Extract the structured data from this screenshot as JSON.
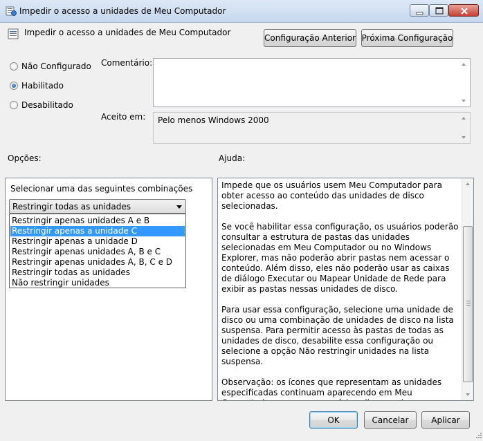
{
  "window": {
    "title": "Impedir o acesso a unidades de Meu Computador",
    "controls": {
      "minimize": "minimize",
      "maximize": "maximize",
      "close": "close"
    }
  },
  "header": {
    "policy_title": "Impedir o acesso a unidades de Meu Computador",
    "prev_button": "Configuração Anterior",
    "next_button": "Próxima Configuração"
  },
  "state": {
    "options": [
      {
        "label": "Não Configurado",
        "checked": false
      },
      {
        "label": "Habilitado",
        "checked": true
      },
      {
        "label": "Desabilitado",
        "checked": false
      }
    ]
  },
  "comment": {
    "label": "Comentário:",
    "value": ""
  },
  "supported": {
    "label": "Aceito em:",
    "value": "Pelo menos Windows 2000"
  },
  "options_section": {
    "label": "Opções:",
    "instruction": "Selecionar uma das seguintes combinações",
    "selected_value": "Restringir todas as unidades",
    "list": [
      "Restringir apenas unidades A e B",
      "Restringir apenas a unidade C",
      "Restringir apenas a unidade D",
      "Restringir apenas unidades A, B e C",
      "Restringir apenas unidades A, B, C e D",
      "Restringir todas as unidades",
      "Não restringir unidades"
    ],
    "highlighted_index": 1
  },
  "help_section": {
    "label": "Ajuda:",
    "paragraphs": [
      "Impede que os usuários usem Meu Computador para obter acesso ao conteúdo das unidades de disco selecionadas.",
      "Se você habilitar essa configuração, os usuários poderão consultar a estrutura de pastas das unidades selecionadas em Meu Computador ou no Windows Explorer, mas não poderão abrir pastas nem acessar o conteúdo. Além disso, eles não poderão usar as caixas de diálogo Executar ou Mapear Unidade de Rede para exibir as pastas nessas unidades de disco.",
      "Para usar essa configuração, selecione uma unidade de disco ou uma combinação de unidades de disco na lista suspensa. Para permitir acesso às pastas de todas as unidades de disco, desabilite essa configuração ou selecione a opção Não restringir unidades na lista suspensa.",
      "Observação: os ícones que representam as unidades especificadas continuam aparecendo em Meu Computador, mas se os usuários clicarem duas vezes nos ícones, será exibida uma mensagem explicando que uma configuração impede a ação."
    ]
  },
  "footer": {
    "ok": "OK",
    "cancel": "Cancelar",
    "apply": "Aplicar"
  },
  "icons": {
    "app": "policy-settings-icon",
    "policy": "policy-document-icon"
  },
  "colors": {
    "selection": "#3399ff",
    "titlebar": "#c6d8ee"
  }
}
